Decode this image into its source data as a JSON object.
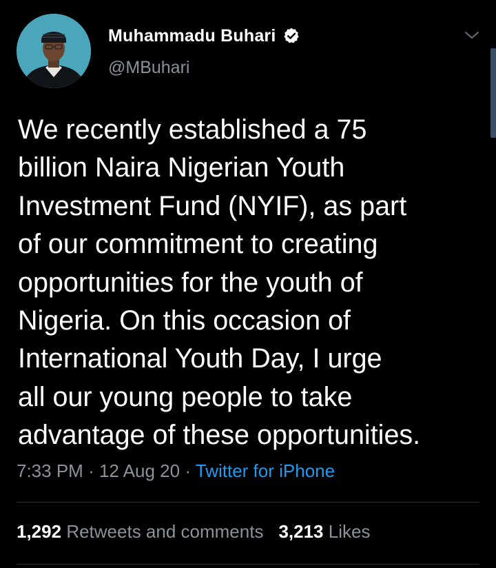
{
  "author": {
    "name": "Muhammadu Buhari",
    "handle": "@MBuhari",
    "verified": true
  },
  "tweet": {
    "lines": [
      "We recently established a 75",
      "billion Naira Nigerian Youth",
      "Investment Fund (NYIF), as part",
      "of our commitment to creating",
      "opportunities for the youth of",
      "Nigeria. On this occasion of",
      "International Youth Day, I urge",
      "all our young people to take",
      "advantage of these opportunities."
    ]
  },
  "meta": {
    "time": "7:33 PM",
    "separator": "·",
    "date": "12 Aug 20",
    "source": "Twitter for iPhone"
  },
  "stats": {
    "retweets_count": "1,292",
    "retweets_label": "Retweets and comments",
    "likes_count": "3,213",
    "likes_label": "Likes"
  },
  "icons": {
    "verified": "verified-badge-icon",
    "menu": "chevron-down-icon"
  },
  "colors": {
    "background": "#000000",
    "text": "#ffffff",
    "secondary": "#8b9299",
    "link": "#1d9bf0",
    "divider": "#2f3336"
  }
}
